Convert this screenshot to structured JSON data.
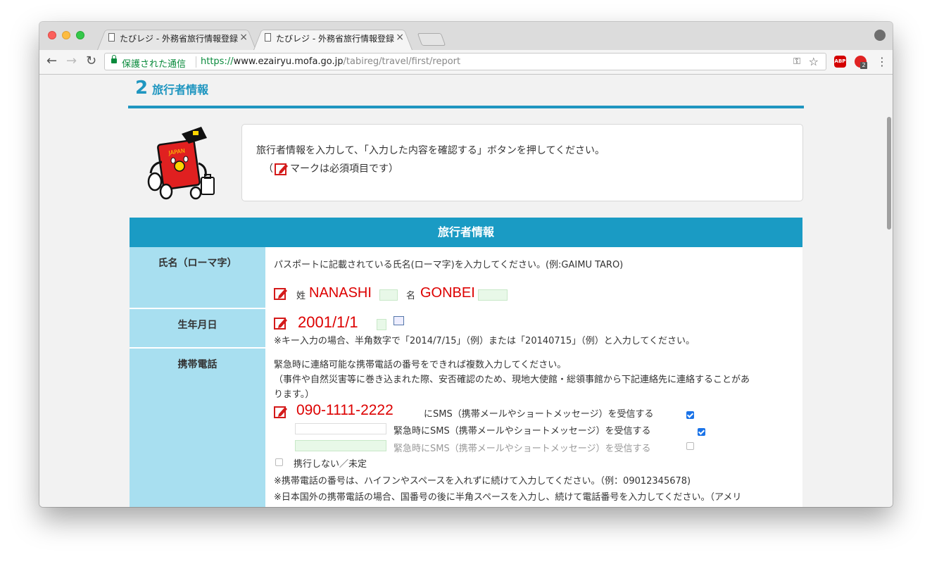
{
  "browser": {
    "tabs": [
      {
        "title": "たびレジ - 外務省旅行情報登録",
        "close": "×"
      },
      {
        "title": "たびレジ - 外務省旅行情報登録",
        "close": "×"
      }
    ],
    "nav": {
      "back": "←",
      "forward": "→",
      "reload": "↻"
    },
    "address": {
      "secure_label": "保護された通信",
      "scheme": "https://",
      "host": "www.ezairyu.mofa.go.jp",
      "path": "/tabireg/travel/first/report"
    },
    "key_icon": "⚿",
    "star_icon": "☆",
    "abp_label": "ABP",
    "ext_badge": "2",
    "menu_icon": "⋮"
  },
  "section": {
    "number": "2",
    "title": "旅行者情報"
  },
  "info": {
    "line1": "旅行者情報を入力して、「入力した内容を確認する」ボタンを押してください。",
    "line2_open": "（",
    "line2_text": "マークは必須項目です）",
    "mascot_text": "JAPAN"
  },
  "form": {
    "header": "旅行者情報",
    "name": {
      "label": "氏名（ローマ字）",
      "instruction": "パスポートに記載されている氏名(ローマ字)を入力してください。(例:GAIMU TARO)",
      "surname_label": "姓",
      "surname_value": "NANASHI",
      "given_label": "名",
      "given_value": "GONBEI"
    },
    "birth": {
      "label": "生年月日",
      "value": "2001/1/1",
      "note": "※キー入力の場合、半角数字で「2014/7/15」（例）または「20140715」（例）と入力してください。"
    },
    "phone": {
      "label": "携帯電話",
      "line1": "緊急時に連絡可能な携帯電話の番号をできれば複数入力してください。",
      "line2": "（事件や自然災害等に巻き込まれた際、安否確認のため、現地大使館・総領事館から下記連絡先に連絡することがあ",
      "line3": "ります。）",
      "number1": "090-1111-2222",
      "sms1": "にSMS（携帯メールやショートメッセージ）を受信する",
      "sms2": "緊急時にSMS（携帯メールやショートメッセージ）を受信する",
      "sms3": "緊急時にSMS（携帯メールやショートメッセージ）を受信する",
      "none_label": "携行しない／未定",
      "note1": "※携帯電話の番号は、ハイフンやスペースを入れずに続けて入力してください。（例：09012345678)",
      "note2": "※日本国外の携帯電話の場合、国番号の後に半角スペースを入力し、続けて電話番号を入力してください。（アメリ"
    }
  }
}
